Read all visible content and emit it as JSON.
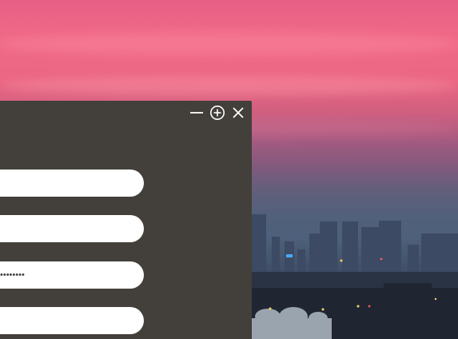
{
  "window": {
    "controls": [
      {
        "name": "minimize-icon",
        "glyph": "minimize"
      },
      {
        "name": "maximize-icon",
        "glyph": "circle-plus"
      },
      {
        "name": "close-icon",
        "glyph": "x"
      }
    ]
  },
  "form": {
    "field_1_value": "",
    "field_2_value": "",
    "field_3_value": "••••••••",
    "field_4_value": ""
  }
}
